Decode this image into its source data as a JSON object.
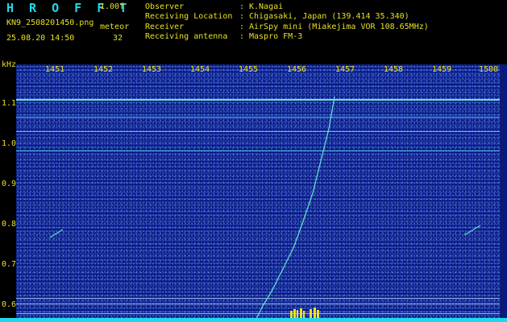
{
  "header": {
    "app_title": "H R O F F T",
    "version": "1.00f",
    "file_name": "KN9_2508201450.png",
    "meteor_label": "meteor",
    "timestamp": "25.08.20 14:50",
    "meteor_count": "32",
    "info": [
      {
        "key": "Observer",
        "sep": ":",
        "value": "K.Nagai"
      },
      {
        "key": "Receiving Location",
        "sep": ":",
        "value": "Chigasaki, Japan (139.414 35.340)"
      },
      {
        "key": "Receiver",
        "sep": ":",
        "value": "AirSpy mini (Miakejima VOR 108.65MHz)"
      },
      {
        "key": "Receiving antenna",
        "sep": ":",
        "value": "Maspro FM-3"
      }
    ]
  },
  "axes": {
    "y_unit": "kHz",
    "y_ticks": [
      "1.1",
      "1.0",
      "0.9",
      "0.8",
      "0.7",
      "0.6"
    ],
    "x_ticks": [
      "1451",
      "1452",
      "1453",
      "1454",
      "1455",
      "1456",
      "1457",
      "1458",
      "1459",
      "1500"
    ]
  },
  "colors": {
    "text": "#e8e020",
    "title": "#22d8e8",
    "background": "#0a1a7a",
    "carrier": "#4fd4e8",
    "meteor_trail": "#5ee0c8"
  }
}
